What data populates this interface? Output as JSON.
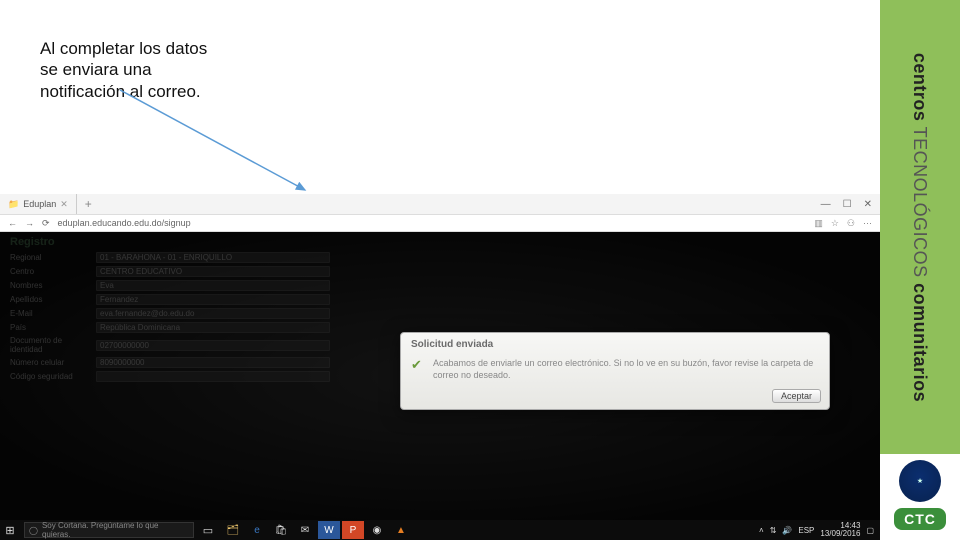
{
  "annotation": "Al completar los datos se enviara una notificación al correo.",
  "browser": {
    "tab_title": "Eduplan",
    "tab_icon": "folder-icon",
    "url": "eduplan.educando.edu.do/signup",
    "window_controls": {
      "min": "—",
      "max": "☐",
      "close": "✕"
    },
    "nav": {
      "back": "←",
      "forward": "→",
      "reload": "⟳"
    },
    "right_icons": {
      "books": "▥",
      "fav": "☆",
      "people": "⚇",
      "menu": "⋯"
    }
  },
  "form": {
    "heading": "Registro",
    "rows": [
      {
        "label": "Regional",
        "value": "01 - BARAHONA - 01 - ENRIQUILLO"
      },
      {
        "label": "Centro",
        "value": "CENTRO EDUCATIVO"
      },
      {
        "label": "Nombres",
        "value": "Eva"
      },
      {
        "label": "Apellidos",
        "value": "Fernandez"
      },
      {
        "label": "E-Mail",
        "value": "eva.fernandez@do.edu.do"
      },
      {
        "label": "País",
        "value": "República Dominicana"
      },
      {
        "label": "Documento de identidad",
        "value": "02700000000"
      },
      {
        "label": "Número celular",
        "value": "8090000000"
      },
      {
        "label": "Código seguridad",
        "value": ""
      }
    ]
  },
  "modal": {
    "title": "Solicitud enviada",
    "body": "Acabamos de enviarle un correo electrónico. Si no lo ve en su buzón, favor revise la carpeta de correo no deseado.",
    "accept": "Aceptar"
  },
  "taskbar": {
    "cortana_placeholder": "Soy Cortana. Pregúntame lo que quieras.",
    "lang": "ESP",
    "time": "14:43",
    "date": "13/09/2016"
  },
  "brand": {
    "w1": "centros",
    "w2": "TECNOLÓGICOS",
    "w3": "comunitarios",
    "ctc": "CTC"
  }
}
